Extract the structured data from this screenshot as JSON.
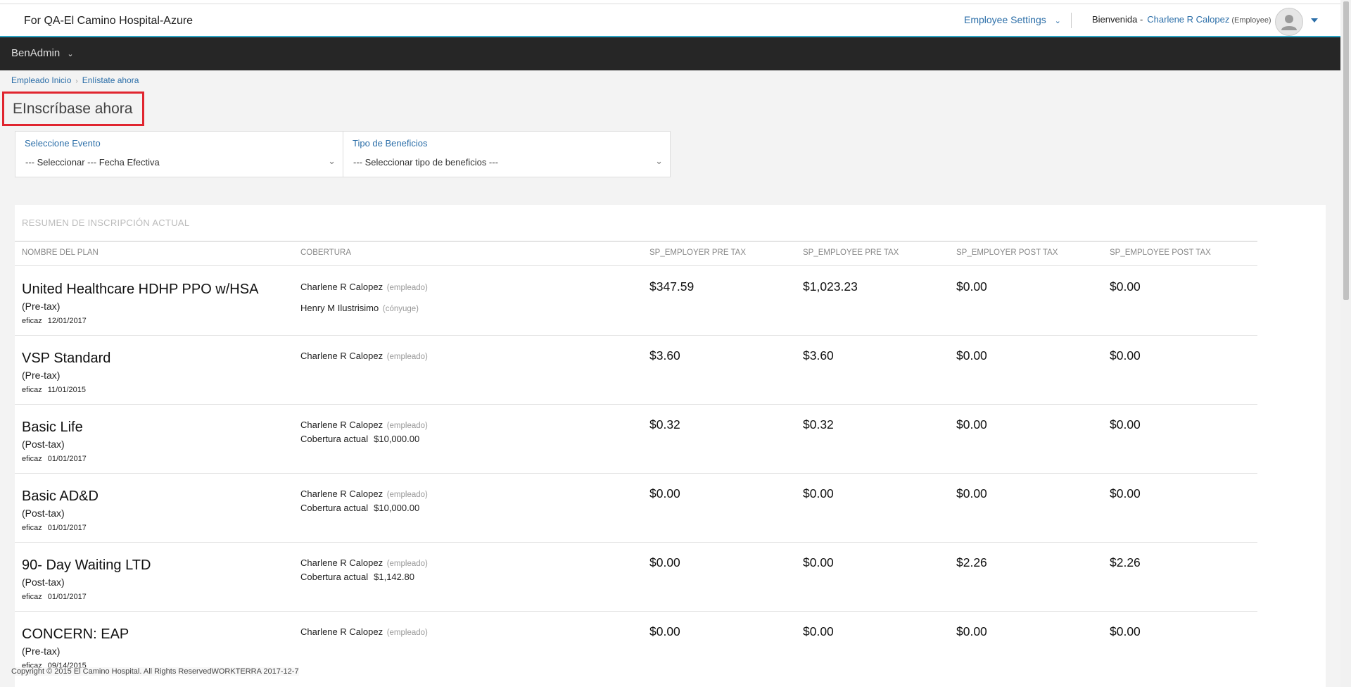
{
  "header": {
    "org_name": "For QA-El Camino Hospital-Azure",
    "employee_settings": "Employee Settings",
    "welcome": "Bienvenida -",
    "user_name": "Charlene R Calopez",
    "user_role": "(Employee)"
  },
  "nav": {
    "main": "BenAdmin"
  },
  "breadcrumb": {
    "home": "Empleado Inicio",
    "current": "Enlístate ahora"
  },
  "page_title": "EInscríbase ahora",
  "filters": {
    "event_label": "Seleccione Evento",
    "event_value": "--- Seleccionar --- Fecha Efectiva",
    "benefit_label": "Tipo de Beneficios",
    "benefit_value": "--- Seleccionar tipo de beneficios ---"
  },
  "summary": {
    "title": "RESUMEN DE INSCRIPCIÓN ACTUAL",
    "columns": [
      "NOMBRE DEL PLAN",
      "COBERTURA",
      "SP_EMPLOYER PRE TAX",
      "SP_EMPLOYEE PRE TAX",
      "SP_EMPLOYER POST TAX",
      "SP_EMPLOYEE POST TAX"
    ],
    "rows": [
      {
        "plan": "United Healthcare HDHP PPO w/HSA",
        "tax": "(Pre-tax)",
        "eff_label": "eficaz",
        "eff_date": "12/01/2017",
        "cov1_name": "Charlene R Calopez",
        "cov1_rel": "(empleado)",
        "cov2_name": "Henry M Ilustrisimo",
        "cov2_rel": "(cónyuge)",
        "er_pre": "$347.59",
        "ee_pre": "$1,023.23",
        "er_post": "$0.00",
        "ee_post": "$0.00"
      },
      {
        "plan": "VSP Standard",
        "tax": "(Pre-tax)",
        "eff_label": "eficaz",
        "eff_date": "11/01/2015",
        "cov1_name": "Charlene R Calopez",
        "cov1_rel": "(empleado)",
        "er_pre": "$3.60",
        "ee_pre": "$3.60",
        "er_post": "$0.00",
        "ee_post": "$0.00"
      },
      {
        "plan": "Basic Life",
        "tax": "(Post-tax)",
        "eff_label": "eficaz",
        "eff_date": "01/01/2017",
        "cov1_name": "Charlene R Calopez",
        "cov1_rel": "(empleado)",
        "coverage_label": "Cobertura actual",
        "coverage_amount": "$10,000.00",
        "er_pre": "$0.32",
        "ee_pre": "$0.32",
        "er_post": "$0.00",
        "ee_post": "$0.00"
      },
      {
        "plan": "Basic AD&D",
        "tax": "(Post-tax)",
        "eff_label": "eficaz",
        "eff_date": "01/01/2017",
        "cov1_name": "Charlene R Calopez",
        "cov1_rel": "(empleado)",
        "coverage_label": "Cobertura actual",
        "coverage_amount": "$10,000.00",
        "er_pre": "$0.00",
        "ee_pre": "$0.00",
        "er_post": "$0.00",
        "ee_post": "$0.00"
      },
      {
        "plan": "90- Day Waiting LTD",
        "tax": "(Post-tax)",
        "eff_label": "eficaz",
        "eff_date": "01/01/2017",
        "cov1_name": "Charlene R Calopez",
        "cov1_rel": "(empleado)",
        "coverage_label": "Cobertura actual",
        "coverage_amount": "$1,142.80",
        "er_pre": "$0.00",
        "ee_pre": "$0.00",
        "er_post": "$2.26",
        "ee_post": "$2.26"
      },
      {
        "plan": "CONCERN: EAP",
        "tax": "(Pre-tax)",
        "eff_label": "eficaz",
        "eff_date": "09/14/2015",
        "cov1_name": "Charlene R Calopez",
        "cov1_rel": "(empleado)",
        "er_pre": "$0.00",
        "ee_pre": "$0.00",
        "er_post": "$0.00",
        "ee_post": "$0.00"
      }
    ]
  },
  "footer": {
    "copyright": "Copyright © 2015 El Camino Hospital. All Rights ReservedWORKTERRA 2017-12-7"
  },
  "icons": {
    "settings_chevron": "chevron-down-icon",
    "avatar": "user-avatar-icon",
    "caret": "caret-down-icon"
  },
  "colors": {
    "link": "#2b6ea8",
    "navbar": "#262626",
    "highlight": "#e0252f",
    "header_accent": "#2aa4c4"
  }
}
